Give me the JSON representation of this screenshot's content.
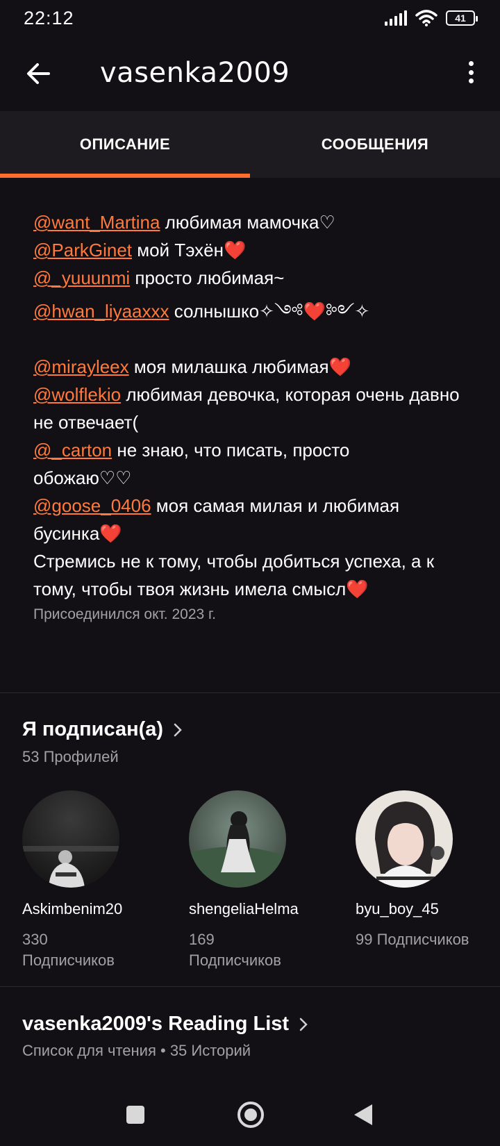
{
  "status": {
    "time": "22:12",
    "battery": "41"
  },
  "header": {
    "title": "vasenka2009"
  },
  "tabs": {
    "about": "ОПИСАНИЕ",
    "messages": "СООБЩЕНИЯ"
  },
  "description": {
    "lines": [
      {
        "mention": "@want_Martina",
        "text": " любимая мамочка♡"
      },
      {
        "mention": "@ParkGinet",
        "text": " мой Тэхён❤️"
      },
      {
        "mention": "@_yuuunmi",
        "text": " просто любимая~"
      },
      {
        "mention": "@hwan_liyaaxxx",
        "text": " солнышко✧༺❤️༻✧"
      },
      {
        "mention": "@mirayleex",
        "text": " моя милашка любимая❤️"
      },
      {
        "mention": "@wolflekio",
        "text": " любимая девочка, которая очень давно не отвечает("
      },
      {
        "mention": "@_carton",
        "text": " не знаю, что писать, просто обожаю♡♡"
      },
      {
        "mention": "@goose_0406",
        "text": " моя самая милая и любимая бусинка❤️"
      }
    ],
    "quote": "Стремись не к тому, чтобы добиться успеха, а к тому, чтобы твоя жизнь имела смысл❤️",
    "joined": "Присоединился окт. 2023 г."
  },
  "following": {
    "title": "Я подписан(а)",
    "count": "53 Профилей",
    "profiles": [
      {
        "name": "Askimbenim20",
        "followers": "330 Подписчиков"
      },
      {
        "name": "shengeliaHelma",
        "followers": "169 Подписчиков"
      },
      {
        "name": "byu_boy_45",
        "followers": "99 Подписчиков"
      }
    ]
  },
  "reading_list": {
    "title": "vasenka2009's Reading List",
    "subtitle": "Список для чтения • 35 Историй"
  },
  "colors": {
    "accent": "#ff6d2e",
    "background": "#121014",
    "tab_bg": "#1d1b1f",
    "muted": "#a3a1a6"
  }
}
